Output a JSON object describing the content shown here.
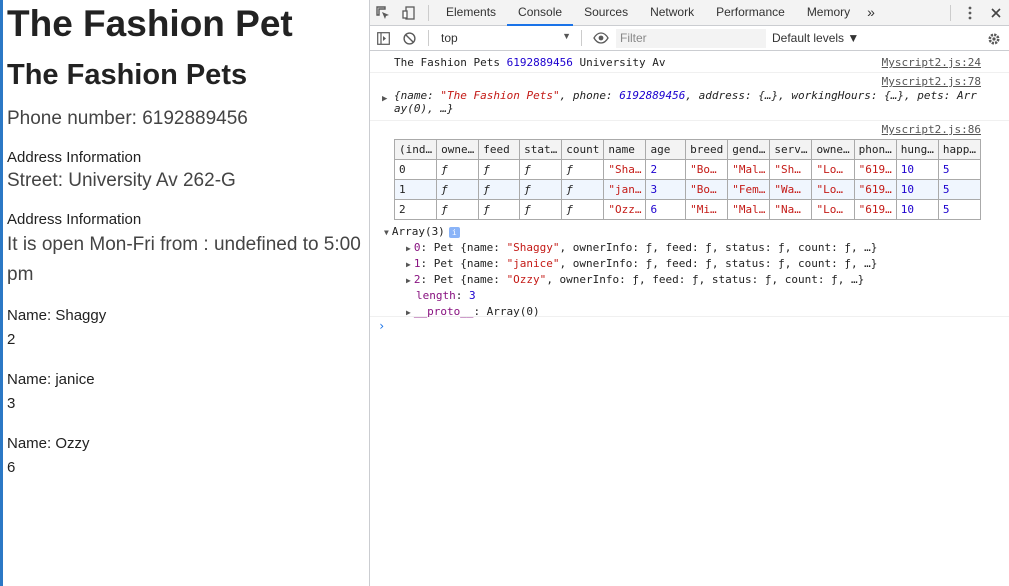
{
  "page": {
    "h1": "The Fashion Pet",
    "h2": "The Fashion Pets",
    "phone": "Phone number: 6192889456",
    "address_heading": "Address Information",
    "street": "Street: University Av 262-G",
    "hours_heading": "Address Information",
    "hours": "It is open Mon-Fri from : undefined to 5:00 pm",
    "pets": [
      {
        "name": "Name: Shaggy",
        "age": "2"
      },
      {
        "name": "Name: janice",
        "age": "3"
      },
      {
        "name": "Name: Ozzy",
        "age": "6"
      }
    ]
  },
  "devtools": {
    "tabs": [
      "Elements",
      "Console",
      "Sources",
      "Network",
      "Performance",
      "Memory"
    ],
    "active_tab": "Console",
    "more": "»",
    "context": "top",
    "filter_placeholder": "Filter",
    "levels": "Default levels ▼",
    "log1": {
      "text_a": "The Fashion Pets ",
      "num": "6192889456",
      "text_b": " University Av",
      "src": "Myscript2.js:24"
    },
    "log2": {
      "src": "Myscript2.js:78",
      "line1_a": "{name: ",
      "line1_str": "\"The Fashion Pets\"",
      "line1_b": ", phone: ",
      "line1_num": "6192889456",
      "line1_c": ", address: {…}, workingHours: {…}, pets: Arr",
      "line2": "ay(0), …}"
    },
    "log3": {
      "src": "Myscript2.js:86",
      "headers": [
        "(ind…",
        "owne…",
        "feed",
        "stat…",
        "count",
        "name",
        "age",
        "breed",
        "gend…",
        "serv…",
        "owne…",
        "phon…",
        "hung…",
        "happ…"
      ],
      "rows": [
        [
          "0",
          "ƒ",
          "ƒ",
          "ƒ",
          "ƒ",
          "\"Sha…",
          "2",
          "\"Bo…",
          "\"Mal…",
          "\"Sh…",
          "\"Lo…",
          "\"619…",
          "10",
          "5"
        ],
        [
          "1",
          "ƒ",
          "ƒ",
          "ƒ",
          "ƒ",
          "\"jan…",
          "3",
          "\"Bo…",
          "\"Fem…",
          "\"Wa…",
          "\"Lo…",
          "\"619…",
          "10",
          "5"
        ],
        [
          "2",
          "ƒ",
          "ƒ",
          "ƒ",
          "ƒ",
          "\"Ozz…",
          "6",
          "\"Mi…",
          "\"Mal…",
          "\"Na…",
          "\"Lo…",
          "\"619…",
          "10",
          "5"
        ]
      ],
      "array_label": "Array(3)",
      "items": [
        {
          "idx": "0",
          "name": "\"Shaggy\""
        },
        {
          "idx": "1",
          "name": "\"janice\""
        },
        {
          "idx": "2",
          "name": "\"Ozzy\""
        }
      ],
      "item_prefix": "Pet {name: ",
      "item_suffix": ", ownerInfo: ƒ, feed: ƒ, status: ƒ, count: ƒ, …}",
      "length_key": "length",
      "length_val": "3",
      "proto_key": "__proto__",
      "proto_val": ": Array(0)"
    },
    "prompt": "›"
  }
}
